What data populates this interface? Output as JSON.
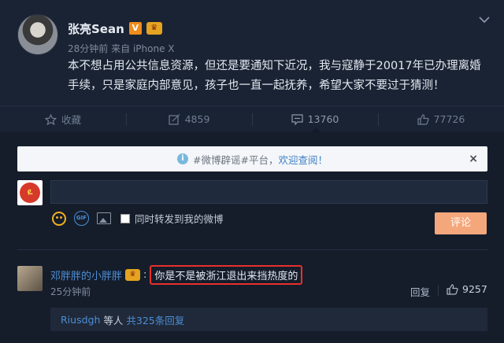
{
  "post": {
    "author": "张亮Sean",
    "badge_v": "V",
    "time": "28分钟前",
    "source_prefix": "来自",
    "source": "iPhone X",
    "text": "本不想占用公共信息资源，但还是要通知下近况，我与寇静于20017年已办理离婚手续，只是家庭内部意见，孩子也一直一起抚养，希望大家不要过于猜测！"
  },
  "actions": {
    "favorite": "收藏",
    "repost": "4859",
    "comment": "13760",
    "like": "77726"
  },
  "notice": {
    "text": "#微博辟谣#平台，",
    "link": "欢迎查阅！",
    "close": "×"
  },
  "composer": {
    "my_avatar_text": "ዪ",
    "repost_label": "同时转发到我的微博",
    "submit": "评论",
    "gif_label": "GIF"
  },
  "comment": {
    "user": "邓胖胖的小胖胖",
    "colon": ":",
    "text": "你是不是被浙江退出来挡热度的",
    "time": "25分钟前",
    "reply": "回复",
    "likes": "9257"
  },
  "replies": {
    "user": "Riusdgh",
    "middle": "等人",
    "count": "共325条回复"
  },
  "colors": {
    "background": "#151d2b",
    "link": "#4d8fd6",
    "highlight_border": "#e8302a",
    "submit_button": "#f5a77c"
  }
}
